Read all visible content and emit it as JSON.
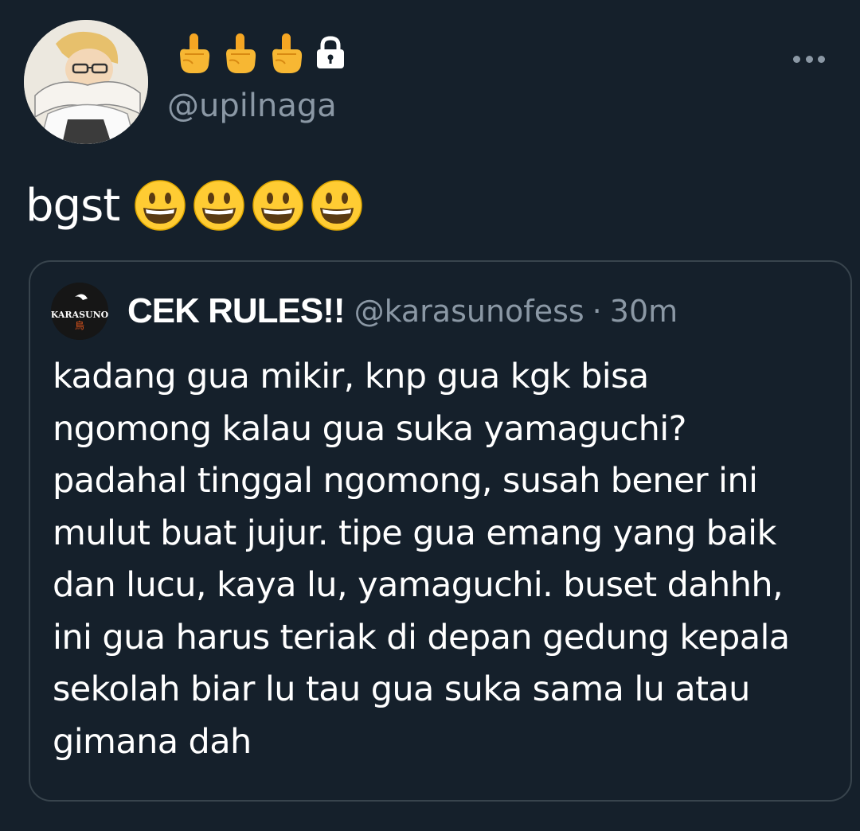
{
  "tweet": {
    "display_name_icons": [
      "middle-finger-icon",
      "middle-finger-icon",
      "middle-finger-icon",
      "lock-icon"
    ],
    "handle": "@upilnaga",
    "text": "bgst",
    "emoji_icons": [
      "smiley-icon",
      "smiley-icon",
      "smiley-icon",
      "smiley-icon"
    ]
  },
  "quote": {
    "avatar_text": "KARASUNO",
    "name": "CEK RULES!!",
    "handle": "@karasunofess",
    "separator": "·",
    "time": "30m",
    "lines": [
      "kadang gua mikir, knp gua kgk bisa",
      "ngomong kalau gua suka yamaguchi?",
      "padahal tinggal ngomong, susah bener ini",
      "mulut buat jujur. tipe gua emang yang baik",
      "dan lucu, kaya lu, yamaguchi. buset dahhh,",
      "ini gua harus teriak di depan gedung kepala",
      "sekolah biar lu tau gua suka sama lu atau",
      "gimana dah"
    ]
  },
  "colors": {
    "background": "#15202b",
    "secondary_text": "#8b98a5",
    "border": "#38444d"
  }
}
